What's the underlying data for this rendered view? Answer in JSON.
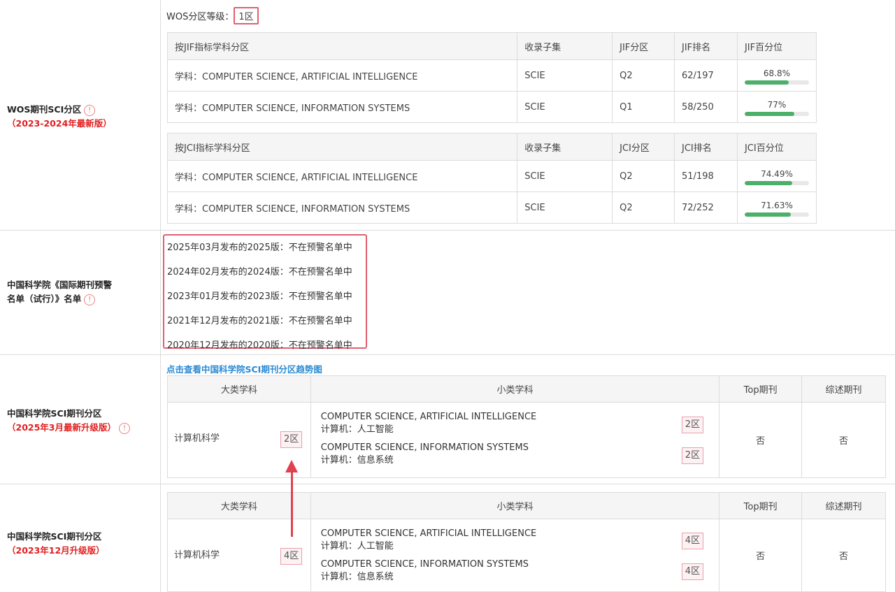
{
  "wos": {
    "label_line1": "WOS期刊SCI分区",
    "label_line2": "（2023-2024年最新版）",
    "level_prefix": "WOS分区等级：",
    "level_value": "1区",
    "jif_table": {
      "headers": [
        "按JIF指标学科分区",
        "收录子集",
        "JIF分区",
        "JIF排名",
        "JIF百分位"
      ],
      "rows": [
        {
          "subject": "学科：COMPUTER SCIENCE, ARTIFICIAL INTELLIGENCE",
          "subset": "SCIE",
          "quartile": "Q2",
          "rank": "62/197",
          "percentile": "68.8%",
          "percentile_value": 68.8
        },
        {
          "subject": "学科：COMPUTER SCIENCE, INFORMATION SYSTEMS",
          "subset": "SCIE",
          "quartile": "Q1",
          "rank": "58/250",
          "percentile": "77%",
          "percentile_value": 77
        }
      ]
    },
    "jci_table": {
      "headers": [
        "按JCI指标学科分区",
        "收录子集",
        "JCI分区",
        "JCI排名",
        "JCI百分位"
      ],
      "rows": [
        {
          "subject": "学科：COMPUTER SCIENCE, ARTIFICIAL INTELLIGENCE",
          "subset": "SCIE",
          "quartile": "Q2",
          "rank": "51/198",
          "percentile": "74.49%",
          "percentile_value": 74.49
        },
        {
          "subject": "学科：COMPUTER SCIENCE, INFORMATION SYSTEMS",
          "subset": "SCIE",
          "quartile": "Q2",
          "rank": "72/252",
          "percentile": "71.63%",
          "percentile_value": 71.63
        }
      ]
    }
  },
  "warning": {
    "label_line1": "中国科学院《国际期刊预警",
    "label_line2": "名单（试行）》名单",
    "items": [
      "2025年03月发布的2025版：不在预警名单中",
      "2024年02月发布的2024版：不在预警名单中",
      "2023年01月发布的2023版：不在预警名单中",
      "2021年12月发布的2021版：不在预警名单中",
      "2020年12月发布的2020版：不在预警名单中"
    ]
  },
  "cas2025": {
    "label_line1": "中国科学院SCI期刊分区",
    "label_line2": "（2025年3月最新升级版）",
    "link": "点击查看中国科学院SCI期刊分区趋势图",
    "headers": [
      "大类学科",
      "小类学科",
      "Top期刊",
      "综述期刊"
    ],
    "major": "计算机科学",
    "major_zone": "2区",
    "minors": [
      {
        "en": "COMPUTER SCIENCE, ARTIFICIAL INTELLIGENCE",
        "cn": "计算机：人工智能",
        "zone": "2区"
      },
      {
        "en": "COMPUTER SCIENCE, INFORMATION SYSTEMS",
        "cn": "计算机：信息系统",
        "zone": "2区"
      }
    ],
    "top": "否",
    "review": "否"
  },
  "cas2023": {
    "label_line1": "中国科学院SCI期刊分区",
    "label_line2": "（2023年12月升级版）",
    "headers": [
      "大类学科",
      "小类学科",
      "Top期刊",
      "综述期刊"
    ],
    "major": "计算机科学",
    "major_zone": "4区",
    "minors": [
      {
        "en": "COMPUTER SCIENCE, ARTIFICIAL INTELLIGENCE",
        "cn": "计算机：人工智能",
        "zone": "4区"
      },
      {
        "en": "COMPUTER SCIENCE, INFORMATION SYSTEMS",
        "cn": "计算机：信息系统",
        "zone": "4区"
      }
    ],
    "top": "否",
    "review": "否"
  }
}
